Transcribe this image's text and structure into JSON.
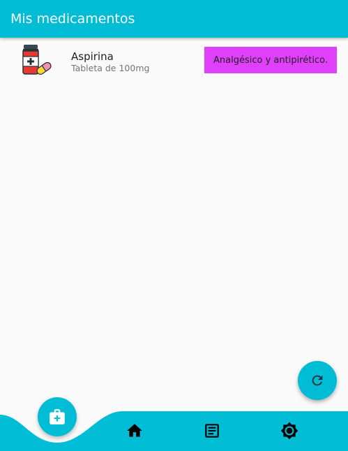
{
  "app_bar": {
    "title": "Mis medicamentos"
  },
  "medications": [
    {
      "name": "Aspirina",
      "dose": "Tableta de 100mg",
      "description": "Analgésico y antipirético.",
      "icon": "medicine-bottle-icon"
    }
  ],
  "fab_refresh": {
    "icon": "refresh-icon"
  },
  "bottom_nav": {
    "active_item": "add-medicine",
    "items": [
      {
        "id": "add-medicine",
        "icon": "medical-kit-icon"
      },
      {
        "id": "home",
        "icon": "home-icon"
      },
      {
        "id": "list",
        "icon": "article-icon"
      },
      {
        "id": "brightness",
        "icon": "brightness-icon"
      }
    ]
  },
  "colors": {
    "primary": "#00bcd4",
    "tag_background": "#e040fb",
    "background": "#fafafa"
  }
}
